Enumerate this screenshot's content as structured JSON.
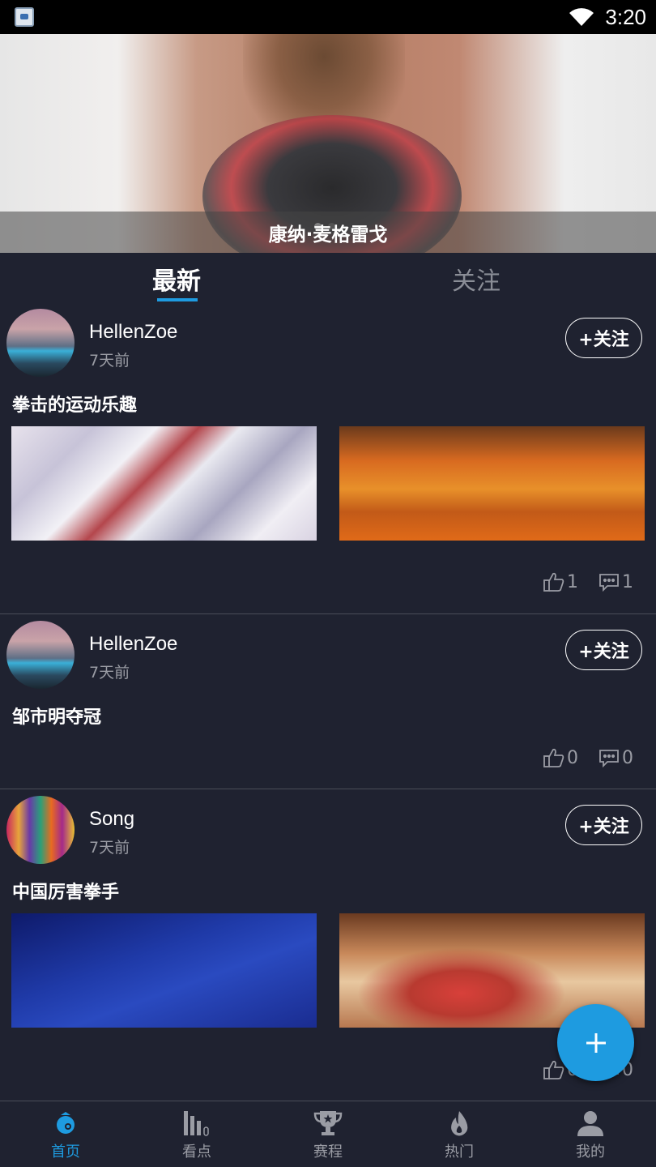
{
  "status_bar": {
    "time": "3:20",
    "app_icon": "app-notification-icon",
    "wifi_icon": "wifi-icon"
  },
  "banner": {
    "caption": "康纳·麦格雷戈",
    "dots": 2,
    "active_dot": 0
  },
  "tabs": [
    {
      "label": "最新",
      "active": true
    },
    {
      "label": "关注",
      "active": false
    }
  ],
  "posts": [
    {
      "user": "HellenZoe",
      "time": "7天前",
      "follow_label": "+关注",
      "title": "拳击的运动乐趣",
      "images": [
        "snowy-houses",
        "autumn-trees"
      ],
      "likes": "1",
      "comments": "1"
    },
    {
      "user": "HellenZoe",
      "time": "7天前",
      "follow_label": "+关注",
      "title": "邹市明夺冠",
      "images": [],
      "likes": "0",
      "comments": "0"
    },
    {
      "user": "Song",
      "time": "7天前",
      "follow_label": "+关注",
      "title": "中国厉害拳手",
      "images": [
        "star-trails-night",
        "flowers"
      ],
      "likes": "0",
      "comments": "0"
    }
  ],
  "fab": {
    "icon": "plus-icon"
  },
  "bottom_nav": [
    {
      "label": "首页",
      "icon": "home-icon",
      "active": true
    },
    {
      "label": "看点",
      "icon": "bar-chart-icon",
      "active": false
    },
    {
      "label": "赛程",
      "icon": "trophy-icon",
      "active": false
    },
    {
      "label": "热门",
      "icon": "flame-icon",
      "active": false
    },
    {
      "label": "我的",
      "icon": "person-icon",
      "active": false
    }
  ],
  "colors": {
    "accent": "#1e9be0",
    "background": "#1f2230",
    "muted_text": "#9a9ca4"
  }
}
